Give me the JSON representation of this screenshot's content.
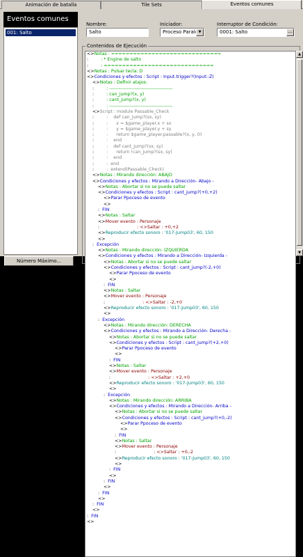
{
  "tabs": [
    "Animación de batalla",
    "Tile Sets",
    "Eventos comunes"
  ],
  "left": {
    "header": "Eventos comunes",
    "items": [
      "001: Salto"
    ],
    "max_button": "Número Máximo..."
  },
  "form": {
    "name_label": "Nombre:",
    "name_value": "Salto",
    "trigger_label": "Iniciador:",
    "trigger_value": "Proceso Paralel",
    "switch_label": "Interruptor de Condición:",
    "switch_value": "0001: Salto",
    "contents_label": "Contenidos de Ejecución"
  },
  "code_lines": [
    {
      "i": 0,
      "p": "<>",
      "t": "Notas : ==============================",
      "c": "note"
    },
    {
      "i": 0,
      "p": ":",
      "t": "         : * Engine de salto",
      "c": "note"
    },
    {
      "i": 0,
      "p": ":",
      "t": "         : ==============================",
      "c": "note"
    },
    {
      "i": 0,
      "p": "<>",
      "t": "Notas : Pulsar tecla: D",
      "c": "note"
    },
    {
      "i": 0,
      "p": "<>",
      "t": "Condiciones y efectos : Script : Input.trigger?(Input::Z)",
      "c": "cond"
    },
    {
      "i": 1,
      "p": "<>",
      "t": "Notas : Definir atajos:",
      "c": "note"
    },
    {
      "i": 1,
      "p": ":",
      "t": "         : ----------------------------------------",
      "c": "note"
    },
    {
      "i": 1,
      "p": ":",
      "t": "         : can_jump?(x, y)",
      "c": "note"
    },
    {
      "i": 1,
      "p": ":",
      "t": "         : cant_jump?(x, y)",
      "c": "note"
    },
    {
      "i": 1,
      "p": ":",
      "t": "         : ----------------------------------------",
      "c": "note"
    },
    {
      "i": 1,
      "p": "<>",
      "t": "Script : module Passable_Check",
      "c": "script"
    },
    {
      "i": 1,
      "p": ":",
      "t": "         :    def can_jump?(sx, sy)",
      "c": "script"
    },
    {
      "i": 1,
      "p": ":",
      "t": "         :      x = $game_player.x + sx",
      "c": "script"
    },
    {
      "i": 1,
      "p": ":",
      "t": "         :      y = $game_player.y + sy",
      "c": "script"
    },
    {
      "i": 1,
      "p": ":",
      "t": "         :      return $game_player.passable?(x, y, 0)",
      "c": "script"
    },
    {
      "i": 1,
      "p": ":",
      "t": "         :    end",
      "c": "script"
    },
    {
      "i": 1,
      "p": ":",
      "t": "         :    def cant_jump?(sx, sy)",
      "c": "script"
    },
    {
      "i": 1,
      "p": ":",
      "t": "         :      return !can_jump?(sx, sy)",
      "c": "script"
    },
    {
      "i": 1,
      "p": ":",
      "t": "         :    end",
      "c": "script"
    },
    {
      "i": 1,
      "p": ":",
      "t": "         :  end",
      "c": "script"
    },
    {
      "i": 1,
      "p": ":",
      "t": "         :  extend(Passable_Check)",
      "c": "script"
    },
    {
      "i": 1,
      "p": "<>",
      "t": "Notas : Mirando dirección: ABAJO",
      "c": "note"
    },
    {
      "i": 1,
      "p": "<>",
      "t": "Condiciones y efectos : Mirando a Dirección- Abajo -",
      "c": "cond"
    },
    {
      "i": 2,
      "p": "<>",
      "t": "Notas : Abortar si no se puede saltar",
      "c": "note"
    },
    {
      "i": 2,
      "p": "<>",
      "t": "Condiciones y efectos : Script : cant_jump?(+0,+2)",
      "c": "cond"
    },
    {
      "i": 3,
      "p": "<>",
      "t": "Parar Ppoceso de evento",
      "c": "cond"
    },
    {
      "i": 3,
      "p": "<>",
      "t": "",
      "c": "black"
    },
    {
      "i": 2,
      "p": ":",
      "t": "  FIN",
      "c": "cond"
    },
    {
      "i": 2,
      "p": "<>",
      "t": "Notas : Saltar",
      "c": "note"
    },
    {
      "i": 2,
      "p": "<>",
      "t": "Mover evento : Personaje",
      "c": "move"
    },
    {
      "i": 2,
      "p": ":",
      "t": "                           : <>Saltar : +0,+2",
      "c": "move"
    },
    {
      "i": 2,
      "p": "<>",
      "t": "Reproducir efecto sonoro : '017-Jump03', 60, 150",
      "c": "sound"
    },
    {
      "i": 2,
      "p": "<>",
      "t": "",
      "c": "black"
    },
    {
      "i": 1,
      "p": ":",
      "t": "  Excepción",
      "c": "cond"
    },
    {
      "i": 2,
      "p": "<>",
      "t": "Notas : Mirando dirección: IZQUIERDA",
      "c": "note"
    },
    {
      "i": 2,
      "p": "<>",
      "t": "Condiciones y efectos : Mirando a Dirección- Izquierda -",
      "c": "cond"
    },
    {
      "i": 3,
      "p": "<>",
      "t": "Notas : Abortar si no se puede saltar",
      "c": "note"
    },
    {
      "i": 3,
      "p": "<>",
      "t": "Condiciones y efectos : Script : cant_jump?(-2,+0)",
      "c": "cond"
    },
    {
      "i": 4,
      "p": "<>",
      "t": "Parar Ppoceso de evento",
      "c": "cond"
    },
    {
      "i": 4,
      "p": "<>",
      "t": "",
      "c": "black"
    },
    {
      "i": 3,
      "p": ":",
      "t": "  FIN",
      "c": "cond"
    },
    {
      "i": 3,
      "p": "<>",
      "t": "Notas : Saltar",
      "c": "note"
    },
    {
      "i": 3,
      "p": "<>",
      "t": "Mover evento : Personaje",
      "c": "move"
    },
    {
      "i": 3,
      "p": ":",
      "t": "                           : <>Saltar : -2,+0",
      "c": "move"
    },
    {
      "i": 3,
      "p": "<>",
      "t": "Reproducir efecto sonoro : '017-Jump03', 60, 150",
      "c": "sound"
    },
    {
      "i": 3,
      "p": "<>",
      "t": "",
      "c": "black"
    },
    {
      "i": 2,
      "p": ":",
      "t": "  Excepción",
      "c": "cond"
    },
    {
      "i": 3,
      "p": "<>",
      "t": "Notas : Mirando dirección: DERECHA",
      "c": "note"
    },
    {
      "i": 3,
      "p": "<>",
      "t": "Condiciones y efectos : Mirando a Dirección- Derecha -",
      "c": "cond"
    },
    {
      "i": 4,
      "p": "<>",
      "t": "Notas : Abortar si no se puede saltar",
      "c": "note"
    },
    {
      "i": 4,
      "p": "<>",
      "t": "Condiciones y efectos : Script : cant_jump?(+2,+0)",
      "c": "cond"
    },
    {
      "i": 5,
      "p": "<>",
      "t": "Parar Ppoceso de evento",
      "c": "cond"
    },
    {
      "i": 5,
      "p": "<>",
      "t": "",
      "c": "black"
    },
    {
      "i": 4,
      "p": ":",
      "t": "  FIN",
      "c": "cond"
    },
    {
      "i": 4,
      "p": "<>",
      "t": "Notas : Saltar",
      "c": "note"
    },
    {
      "i": 4,
      "p": "<>",
      "t": "Mover evento : Personaje",
      "c": "move"
    },
    {
      "i": 4,
      "p": ":",
      "t": "                           : <>Saltar : +2,+0",
      "c": "move"
    },
    {
      "i": 4,
      "p": "<>",
      "t": "Reproducir efecto sonoro : '017-Jump03', 60, 150",
      "c": "sound"
    },
    {
      "i": 4,
      "p": "<>",
      "t": "",
      "c": "black"
    },
    {
      "i": 3,
      "p": ":",
      "t": "  Excepción",
      "c": "cond"
    },
    {
      "i": 4,
      "p": "<>",
      "t": "Notas : Mirando dirección: ARRIBA",
      "c": "note"
    },
    {
      "i": 4,
      "p": "<>",
      "t": "Condiciones y efectos : Mirando a Dirección- Arriba -",
      "c": "cond"
    },
    {
      "i": 5,
      "p": "<>",
      "t": "Notas : Abortar si no se puede saltar",
      "c": "note"
    },
    {
      "i": 5,
      "p": "<>",
      "t": "Condiciones y efectos : Script : cant_jump?(+0,-2)",
      "c": "cond"
    },
    {
      "i": 6,
      "p": "<>",
      "t": "Parar Ppoceso de evento",
      "c": "cond"
    },
    {
      "i": 6,
      "p": "<>",
      "t": "",
      "c": "black"
    },
    {
      "i": 5,
      "p": ":",
      "t": "  FIN",
      "c": "cond"
    },
    {
      "i": 5,
      "p": "<>",
      "t": "Notas : Saltar",
      "c": "note"
    },
    {
      "i": 5,
      "p": "<>",
      "t": "Mover evento : Personaje",
      "c": "move"
    },
    {
      "i": 5,
      "p": ":",
      "t": "                           : <>Saltar : +0,-2",
      "c": "move"
    },
    {
      "i": 5,
      "p": "<>",
      "t": "Reproducir efecto sonoro : '017-Jump03', 60, 150",
      "c": "sound"
    },
    {
      "i": 5,
      "p": "<>",
      "t": "",
      "c": "black"
    },
    {
      "i": 4,
      "p": ":",
      "t": "  FIN",
      "c": "cond"
    },
    {
      "i": 4,
      "p": "<>",
      "t": "",
      "c": "black"
    },
    {
      "i": 3,
      "p": ":",
      "t": "  FIN",
      "c": "cond"
    },
    {
      "i": 3,
      "p": "<>",
      "t": "",
      "c": "black"
    },
    {
      "i": 2,
      "p": ":",
      "t": "  FIN",
      "c": "cond"
    },
    {
      "i": 2,
      "p": "<>",
      "t": "",
      "c": "black"
    },
    {
      "i": 1,
      "p": ":",
      "t": "  FIN",
      "c": "cond"
    },
    {
      "i": 1,
      "p": "<>",
      "t": "",
      "c": "black"
    },
    {
      "i": 0,
      "p": ":",
      "t": "  FIN",
      "c": "cond"
    },
    {
      "i": 0,
      "p": "<>",
      "t": "",
      "c": "black"
    }
  ],
  "colors": {
    "note": "#00a000",
    "cond": "#0000c8",
    "move": "#8b0000",
    "sound": "#008080",
    "script": "#808080"
  }
}
